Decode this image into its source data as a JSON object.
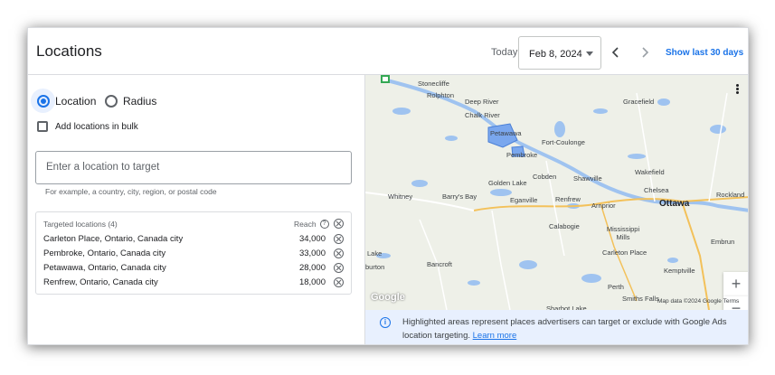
{
  "header": {
    "title": "Locations",
    "today_label": "Today",
    "date_value": "Feb 8, 2024",
    "show_last_label": "Show last 30 days"
  },
  "targeting": {
    "mode_location": "Location",
    "mode_radius": "Radius",
    "selected_mode": "Location",
    "bulk_label": "Add locations in bulk",
    "input_placeholder": "Enter a location to target",
    "hint": "For example, a country, city, region, or postal code"
  },
  "targets": {
    "header_label": "Targeted locations (4)",
    "reach_label": "Reach",
    "rows": [
      {
        "name": "Carleton Place, Ontario, Canada city",
        "reach": "34,000"
      },
      {
        "name": "Pembroke, Ontario, Canada city",
        "reach": "33,000"
      },
      {
        "name": "Petawawa, Ontario, Canada city",
        "reach": "28,000"
      },
      {
        "name": "Renfrew, Ontario, Canada city",
        "reach": "18,000"
      }
    ]
  },
  "map": {
    "labels": {
      "stonecliffe": "Stonecliffe",
      "rolphton": "Rolphton",
      "deep_river": "Deep River",
      "chalk_river": "Chalk River",
      "petawawa": "Petawawa",
      "fort_coulonge": "Fort-Coulonge",
      "pembroke": "Pembroke",
      "cobden": "Cobden",
      "shawville": "Shawville",
      "golden_lake": "Golden Lake",
      "whitney": "Whitney",
      "barrys_bay": "Barry's Bay",
      "eganville": "Eganville",
      "renfrew": "Renfrew",
      "arnprior": "Arnprior",
      "gracefield": "Gracefield",
      "wakefield": "Wakefield",
      "chelsea": "Chelsea",
      "ottawa": "Ottawa",
      "calabogie": "Calabogie",
      "mississippi_mills": "Mississippi\nMills",
      "carleton_place": "Carleton Place",
      "kemptville": "Kemptville",
      "embrun": "Embrun",
      "rockland": "Rockland",
      "bancroft": "Bancroft",
      "perth": "Perth",
      "smiths_falls": "Smiths Falls",
      "sharbot_lake": "Sharbot Lake",
      "lake": "Lake",
      "burton": "burton"
    },
    "google": "Google",
    "attribution": "Map data ©2024 Google   Terms",
    "zoom_in": "+",
    "zoom_out": "−",
    "info_text": "Highlighted areas represent places advertisers can target or exclude with Google Ads location targeting.",
    "learn_more": "Learn more",
    "colors": {
      "water": "#9fc3f0",
      "land": "#eef0e8",
      "highway": "#f3c15a",
      "road": "#ffffff",
      "target": "#7aa7ee"
    }
  }
}
